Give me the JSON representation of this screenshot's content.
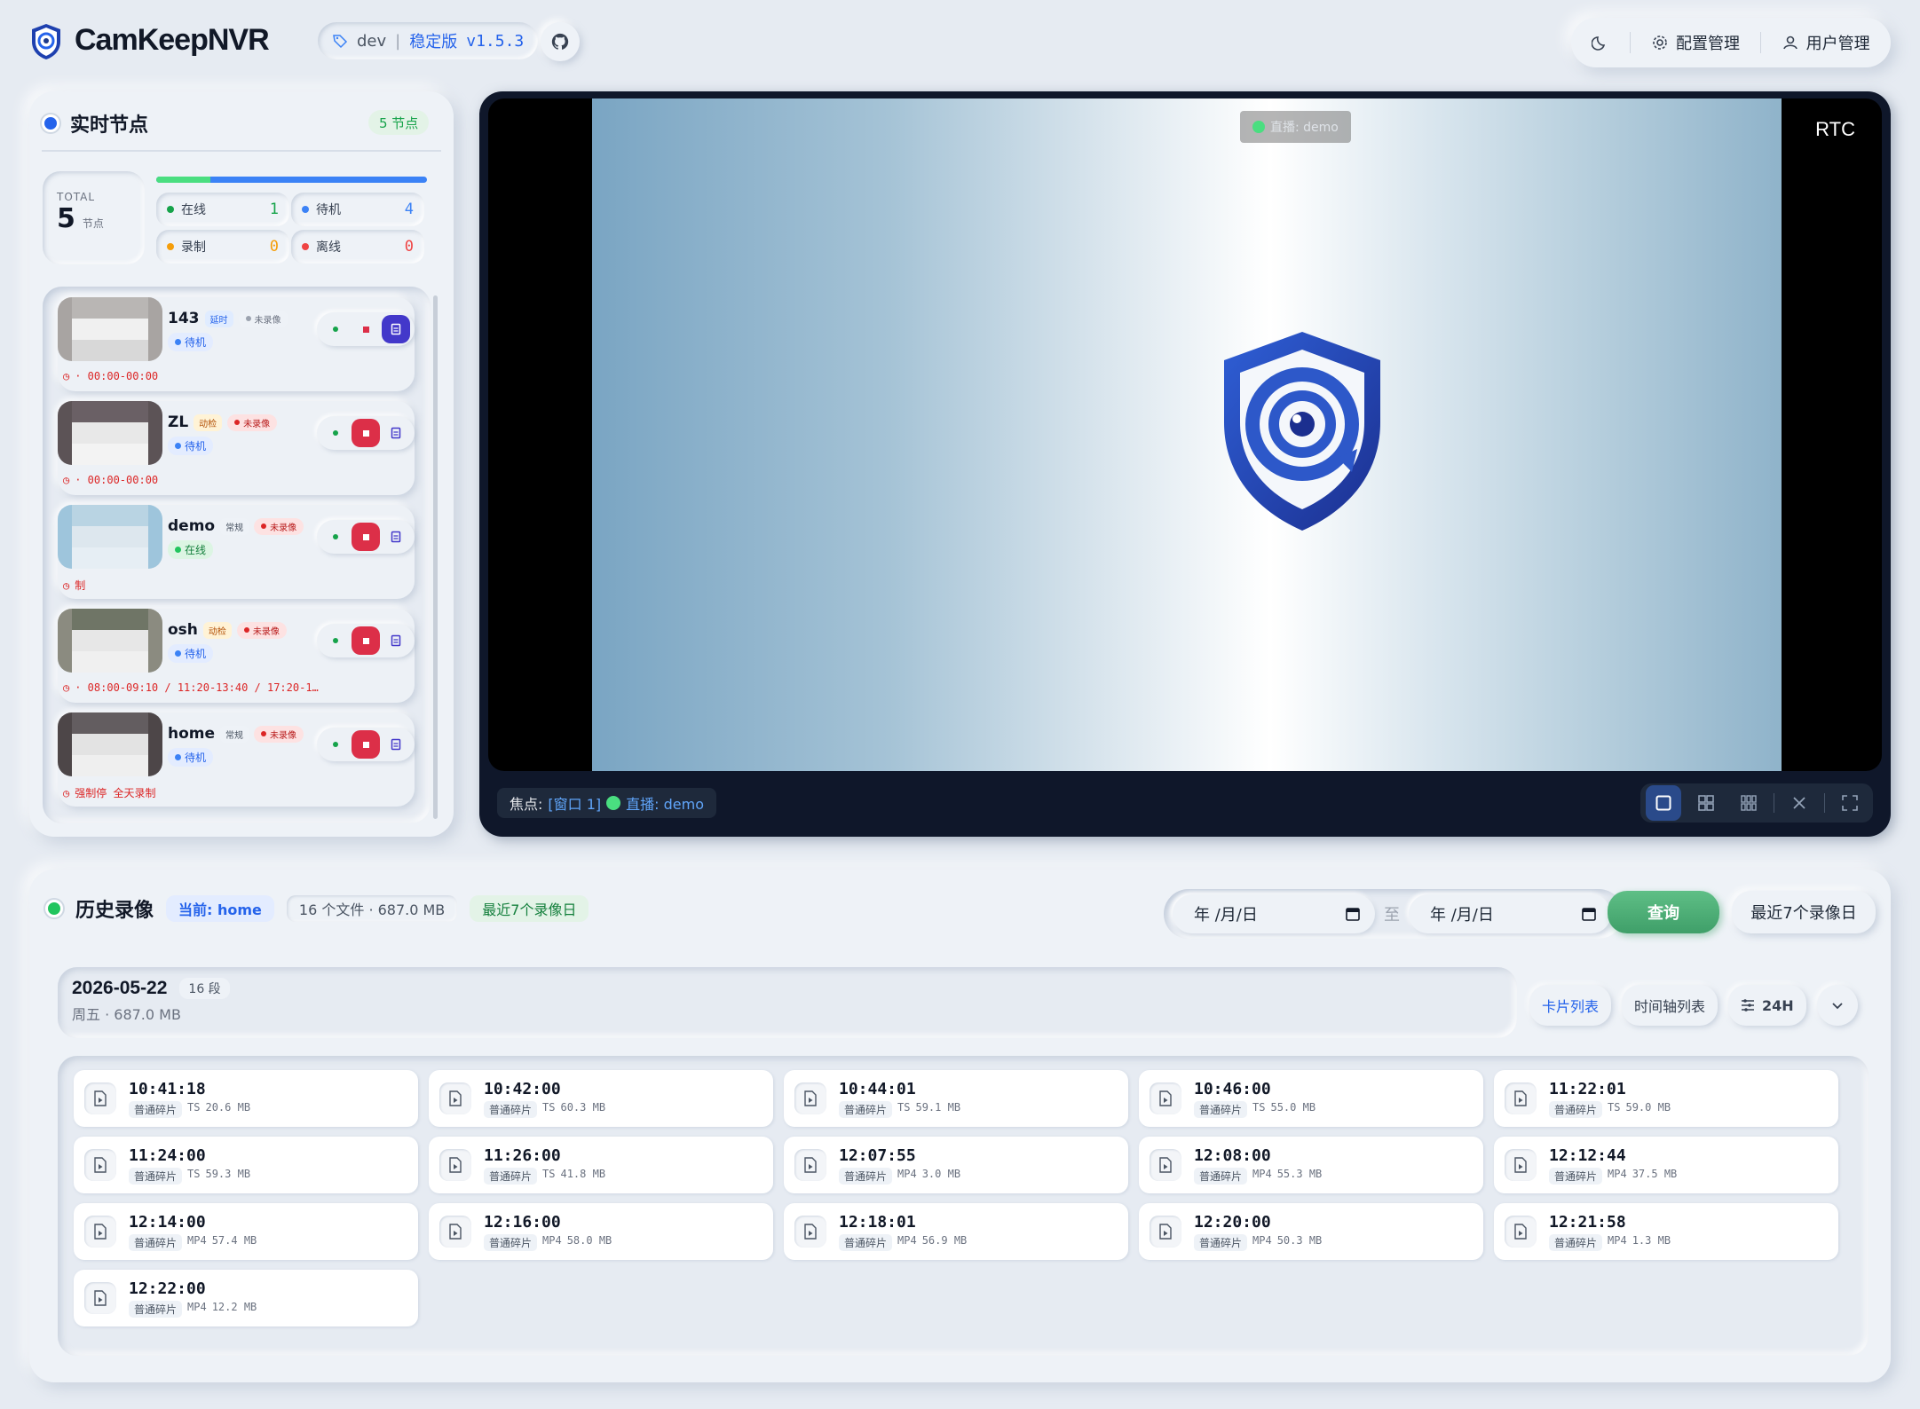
{
  "header": {
    "brand": "CamKeepNVR",
    "env": "dev",
    "channel": "稳定版",
    "version": "v1.5.3",
    "config_label": "配置管理",
    "users_label": "用户管理"
  },
  "nodes_panel": {
    "title": "实时节点",
    "count_badge": "5 节点",
    "total_caption": "TOTAL",
    "total_value": "5",
    "total_unit": "节点",
    "online_fraction": 0.2,
    "stats": [
      {
        "label": "在线",
        "value": "1",
        "color": "#16a34a"
      },
      {
        "label": "待机",
        "value": "4",
        "color": "#3b82f6"
      },
      {
        "label": "录制",
        "value": "0",
        "color": "#f59e0b"
      },
      {
        "label": "离线",
        "value": "0",
        "color": "#ef4444"
      }
    ],
    "nodes": [
      {
        "name": "143",
        "tag": "延时",
        "rec": "未录像",
        "status": "待机",
        "schedule": "· 00:00-00:00"
      },
      {
        "name": "ZL",
        "tag": "动检",
        "rec": "未录像",
        "status": "待机",
        "schedule": "· 00:00-00:00"
      },
      {
        "name": "demo",
        "tag": "常规",
        "rec": "未录像",
        "status": "在线",
        "schedule": "制"
      },
      {
        "name": "osh",
        "tag": "动检",
        "rec": "未录像",
        "status": "待机",
        "schedule": "· 08:00-09:10 / 11:20-13:40 / 17:20-1…"
      },
      {
        "name": "home",
        "tag": "常规",
        "rec": "未录像",
        "status": "待机",
        "schedule": "强制停 全天录制"
      }
    ]
  },
  "video": {
    "rtc_label": "RTC",
    "live_chip": "直播: demo",
    "focus_prefix": "焦点:",
    "focus_window": "[窗口 1]",
    "focus_stream": "直播: demo"
  },
  "history": {
    "title": "历史录像",
    "current_chip": "当前: home",
    "files_chip": "16 个文件 · 687.0 MB",
    "recent_chip": "最近7个录像日",
    "date_placeholder_from": "年 /月/日",
    "date_sep": "至",
    "date_placeholder_to": "年 /月/日",
    "query_label": "查询",
    "recent_btn": "最近7个录像日",
    "day_date": "2026-05-22",
    "day_count": "16 段",
    "day_sub": "周五 · 687.0 MB",
    "view_card": "卡片列表",
    "view_timeline": "时间轴列表",
    "view_24h": "24H",
    "records": [
      {
        "time": "10:41:18",
        "kind": "普通碎片",
        "fmt": "TS",
        "size": "20.6 MB"
      },
      {
        "time": "10:42:00",
        "kind": "普通碎片",
        "fmt": "TS",
        "size": "60.3 MB"
      },
      {
        "time": "10:44:01",
        "kind": "普通碎片",
        "fmt": "TS",
        "size": "59.1 MB"
      },
      {
        "time": "10:46:00",
        "kind": "普通碎片",
        "fmt": "TS",
        "size": "55.0 MB"
      },
      {
        "time": "11:22:01",
        "kind": "普通碎片",
        "fmt": "TS",
        "size": "59.0 MB"
      },
      {
        "time": "11:24:00",
        "kind": "普通碎片",
        "fmt": "TS",
        "size": "59.3 MB"
      },
      {
        "time": "11:26:00",
        "kind": "普通碎片",
        "fmt": "TS",
        "size": "41.8 MB"
      },
      {
        "time": "12:07:55",
        "kind": "普通碎片",
        "fmt": "MP4",
        "size": "3.0 MB"
      },
      {
        "time": "12:08:00",
        "kind": "普通碎片",
        "fmt": "MP4",
        "size": "55.3 MB"
      },
      {
        "time": "12:12:44",
        "kind": "普通碎片",
        "fmt": "MP4",
        "size": "37.5 MB"
      },
      {
        "time": "12:14:00",
        "kind": "普通碎片",
        "fmt": "MP4",
        "size": "57.4 MB"
      },
      {
        "time": "12:16:00",
        "kind": "普通碎片",
        "fmt": "MP4",
        "size": "58.0 MB"
      },
      {
        "time": "12:18:01",
        "kind": "普通碎片",
        "fmt": "MP4",
        "size": "56.9 MB"
      },
      {
        "time": "12:20:00",
        "kind": "普通碎片",
        "fmt": "MP4",
        "size": "50.3 MB"
      },
      {
        "time": "12:21:58",
        "kind": "普通碎片",
        "fmt": "MP4",
        "size": "1.3 MB"
      },
      {
        "time": "12:22:00",
        "kind": "普通碎片",
        "fmt": "MP4",
        "size": "12.2 MB"
      }
    ]
  }
}
